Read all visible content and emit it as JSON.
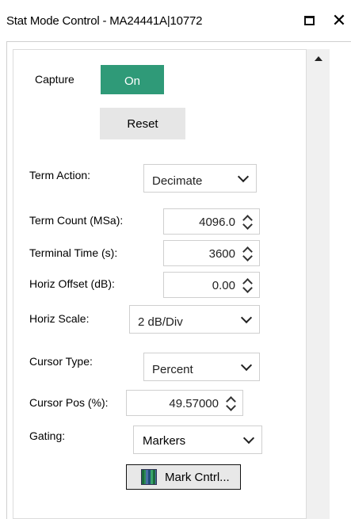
{
  "window": {
    "title": "Stat Mode Control - MA24441A|10772",
    "maximize_icon": "maximize-icon",
    "close_icon": "close-icon",
    "close_glyph": "✕"
  },
  "capture": {
    "label": "Capture",
    "toggle_value": "On",
    "toggle_color": "#2f9a78"
  },
  "reset": {
    "label": "Reset"
  },
  "term_action": {
    "label": "Term Action:",
    "value": "Decimate"
  },
  "term_count": {
    "label": "Term Count (MSa):",
    "value": "4096.0"
  },
  "terminal_time": {
    "label": "Terminal Time (s):",
    "value": "3600"
  },
  "horiz_offset": {
    "label": "Horiz Offset (dB):",
    "value": "0.00"
  },
  "horiz_scale": {
    "label": "Horiz Scale:",
    "value": "2 dB/Div"
  },
  "cursor_type": {
    "label": "Cursor Type:",
    "value": "Percent"
  },
  "cursor_pos": {
    "label": "Cursor Pos (%):",
    "value": "49.57000"
  },
  "gating": {
    "label": "Gating:",
    "value": "Markers"
  },
  "mark_cntrl": {
    "label": "Mark Cntrl...",
    "icon": "marker-control-icon"
  }
}
